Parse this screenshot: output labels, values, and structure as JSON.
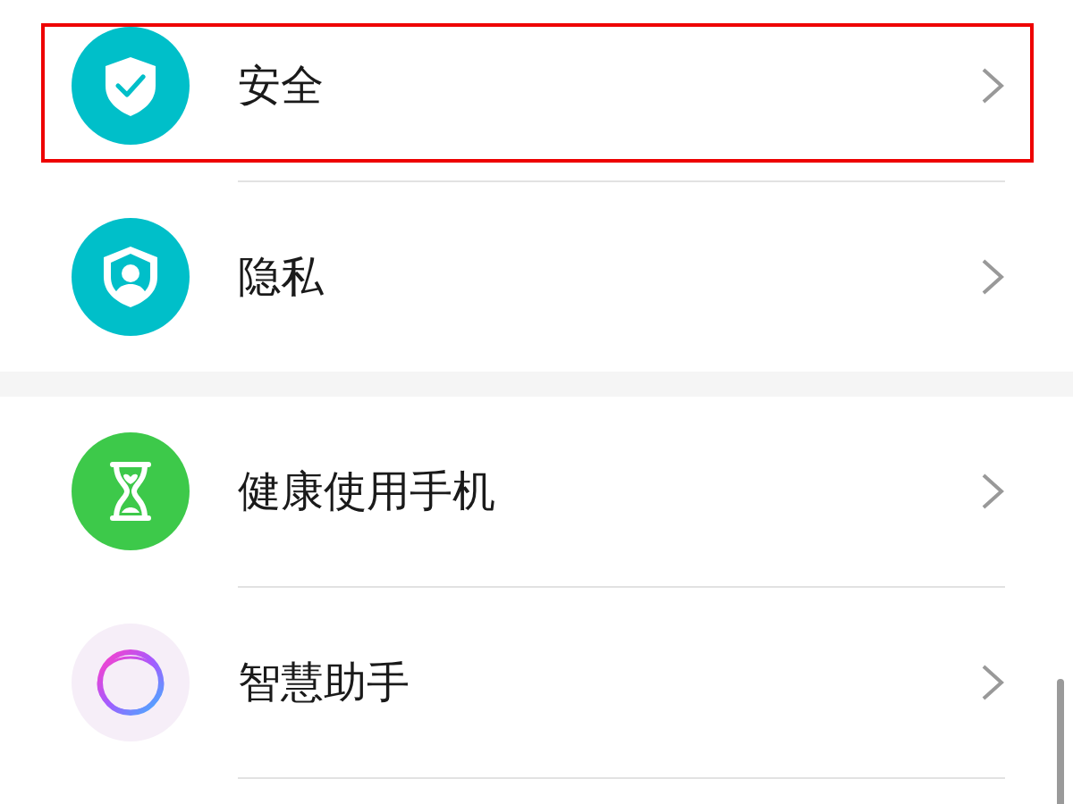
{
  "groups": [
    {
      "items": [
        {
          "label": "安全",
          "kind": "security",
          "highlighted": true
        },
        {
          "label": "隐私",
          "kind": "privacy",
          "highlighted": false
        }
      ]
    },
    {
      "items": [
        {
          "label": "健康使用手机",
          "kind": "hourglass",
          "highlighted": false
        },
        {
          "label": "智慧助手",
          "kind": "assistant",
          "highlighted": false
        }
      ]
    }
  ]
}
